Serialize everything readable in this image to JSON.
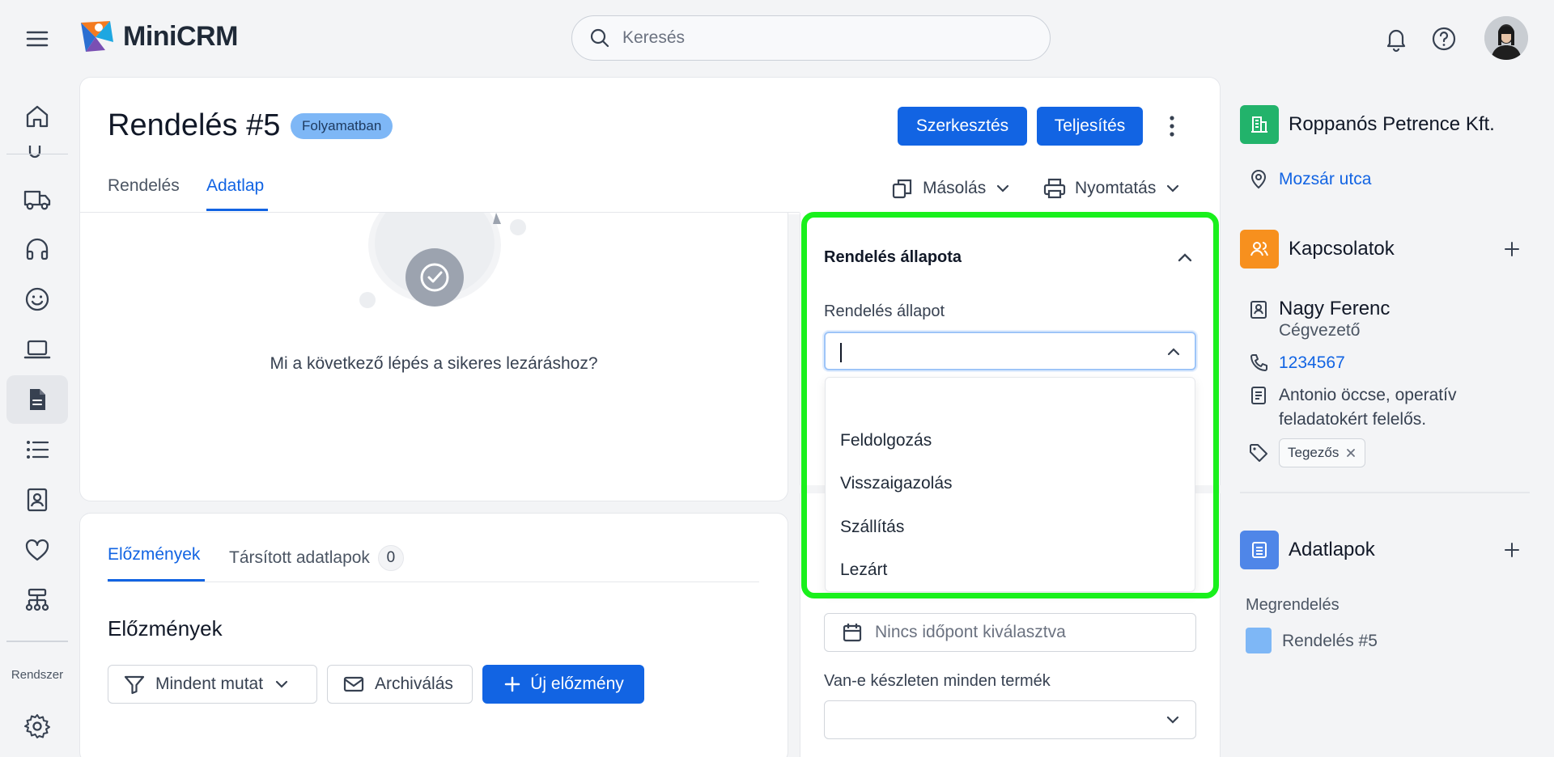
{
  "header": {
    "logo_text": "MiniCRM",
    "search_placeholder": "Keresés"
  },
  "nav": {
    "system_label": "Rendszer"
  },
  "order": {
    "title": "Rendelés #5",
    "status": "Folyamatban",
    "edit_label": "Szerkesztés",
    "complete_label": "Teljesítés",
    "tabs": [
      {
        "label": "Rendelés",
        "active": false
      },
      {
        "label": "Adatlap",
        "active": true
      }
    ],
    "copy_label": "Másolás",
    "print_label": "Nyomtatás"
  },
  "next_step": {
    "text": "Mi a következő lépés a sikeres lezáráshoz?"
  },
  "history": {
    "tabs": [
      {
        "label": "Előzmények",
        "active": true
      },
      {
        "label": "Társított adatlapok",
        "count": "0"
      }
    ],
    "title": "Előzmények",
    "filter_label": "Mindent mutat",
    "archive_label": "Archiválás",
    "new_label": "Új előzmény"
  },
  "order_status": {
    "section_title": "Rendelés állapota",
    "field_label": "Rendelés állapot",
    "input_value": "",
    "options": [
      "Feldolgozás",
      "Visszaigazolás",
      "Szállítás",
      "Lezárt"
    ],
    "date_placeholder": "Nincs időpont kiválasztva",
    "stock_label": "Van-e készleten minden termék",
    "stock_value": "",
    "highlight_color": "#19f01c"
  },
  "company": {
    "name": "Roppanós Petrence Kft.",
    "address": "Mozsár utca",
    "icon_color": "#22b36b"
  },
  "contacts": {
    "title": "Kapcsolatok",
    "icon_color": "#f7901e",
    "person": {
      "name": "Nagy Ferenc",
      "role": "Cégvezető",
      "phone": "1234567",
      "note_line1": "Antonio öccse, operatív",
      "note_line2": "feladatokért felelős.",
      "tag": "Tegezős"
    }
  },
  "datasheets": {
    "title": "Adatlapok",
    "icon_color": "#4f86e8",
    "group": "Megrendelés",
    "item": "Rendelés #5",
    "item_color": "#7eb7f6"
  }
}
